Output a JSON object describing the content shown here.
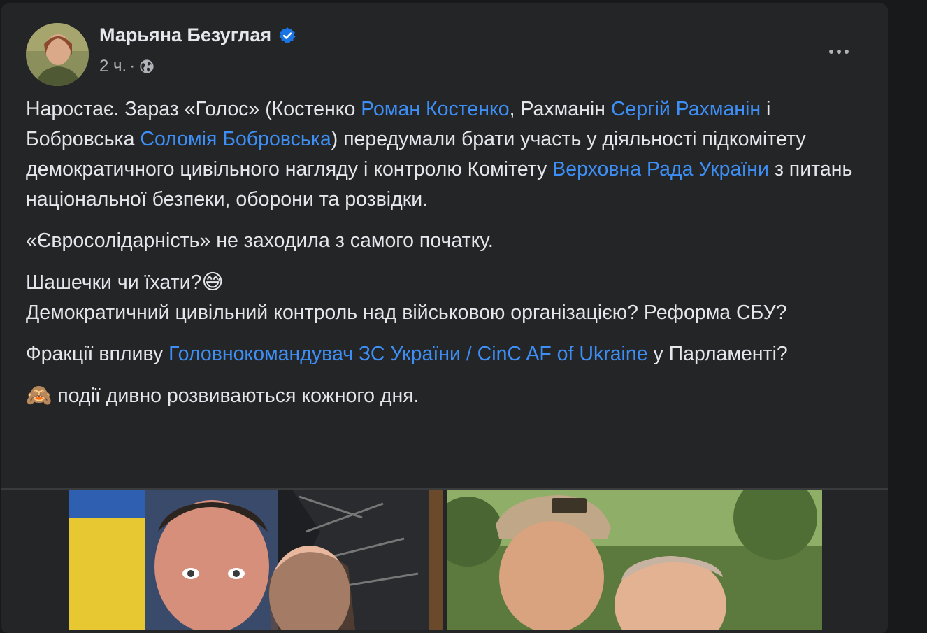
{
  "post": {
    "author": "Марьяна Безуглая",
    "time": "2 ч.",
    "meta_separator": "·",
    "icons": {
      "verified": "verified-badge-icon",
      "audience": "globe-icon",
      "more": "more-options-icon"
    },
    "accent_color": "#3d8ef5",
    "paragraphs": [
      [
        {
          "t": "Наростає. Зараз «Голос» (Костенко "
        },
        {
          "t": "Роман Костенко",
          "link": true
        },
        {
          "t": ", Рахманін "
        },
        {
          "t": "Сергій Рахманін",
          "link": true
        },
        {
          "t": " і Бобровська "
        },
        {
          "t": "Соломія Бобровська",
          "link": true
        },
        {
          "t": ") передумали брати участь у діяльності підкомітету демократичного цивільного нагляду і контролю Комітету "
        },
        {
          "t": "Верховна Рада України",
          "link": true
        },
        {
          "t": " з питань національної безпеки, оборони та розвідки."
        }
      ],
      [
        {
          "t": "«Євросолідарність» не заходила з самого початку."
        }
      ],
      [
        {
          "t": "Шашечки чи їхати?"
        },
        {
          "t": "😅",
          "emoji": true
        },
        {
          "br": true
        },
        {
          "t": "Демократичний цивільний контроль над військовою організацією? Реформа СБУ?"
        }
      ],
      [
        {
          "t": "Фракції впливу "
        },
        {
          "t": "Головнокомандувач ЗС України / CinC AF of Ukraine",
          "link": true
        },
        {
          "t": " у Парламенті?"
        }
      ],
      [
        {
          "t": "🙈",
          "emoji": true
        },
        {
          "t": " події дивно розвиваються кожного дня."
        }
      ]
    ],
    "photos": [
      "post-photo-left",
      "post-photo-right"
    ]
  }
}
